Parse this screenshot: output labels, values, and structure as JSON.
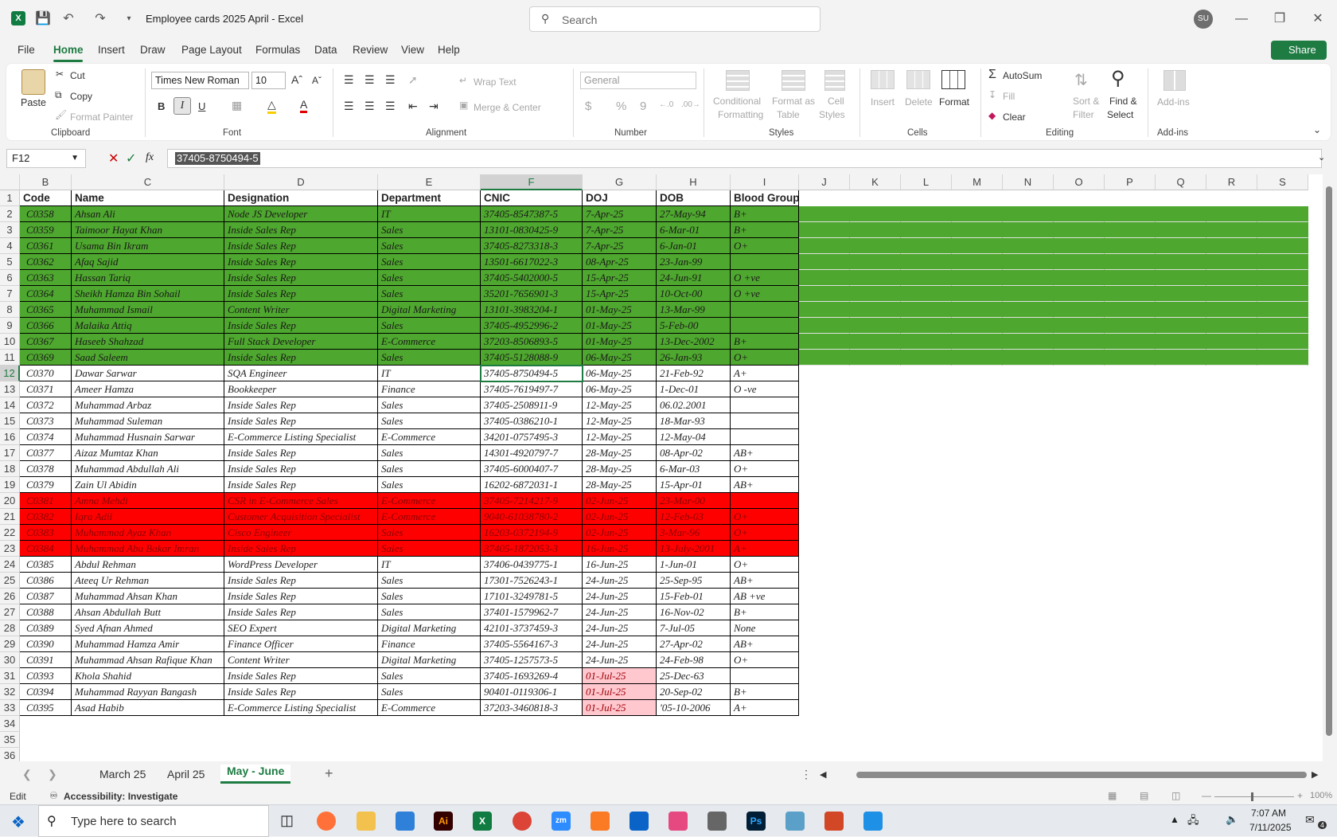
{
  "titlebar": {
    "doc_title": "Employee cards 2025 April  -  Excel",
    "search_placeholder": "Search",
    "avatar": "SU"
  },
  "menu": [
    "File",
    "Home",
    "Insert",
    "Draw",
    "Page Layout",
    "Formulas",
    "Data",
    "Review",
    "View",
    "Help"
  ],
  "share_label": "Share",
  "ribbon": {
    "clipboard": {
      "paste": "Paste",
      "cut": "Cut",
      "copy": "Copy",
      "format_painter": "Format Painter",
      "label": "Clipboard"
    },
    "font": {
      "name": "Times New Roman",
      "size": "10",
      "bold": "B",
      "italic": "I",
      "underline": "U",
      "label": "Font"
    },
    "alignment": {
      "wrap": "Wrap Text",
      "merge": "Merge & Center",
      "label": "Alignment"
    },
    "number": {
      "format": "General",
      "dollar": "$",
      "percent": "%",
      "comma": "9",
      "label": "Number"
    },
    "styles": {
      "cond1": "Conditional",
      "cond2": "Formatting",
      "fmt1": "Format as",
      "fmt2": "Table",
      "cell1": "Cell",
      "cell2": "Styles",
      "label": "Styles"
    },
    "cells": {
      "insert": "Insert",
      "delete": "Delete",
      "format": "Format",
      "label": "Cells"
    },
    "editing": {
      "autosum": "AutoSum",
      "fill": "Fill",
      "clear": "Clear",
      "sort1": "Sort &",
      "sort2": "Filter",
      "find1": "Find &",
      "find2": "Select",
      "label": "Editing"
    },
    "addins": {
      "btn": "Add-ins",
      "label": "Add-ins"
    }
  },
  "formula": {
    "namebox": "F12",
    "value": "37405-8750494-5"
  },
  "columns": [
    "B",
    "C",
    "D",
    "E",
    "F",
    "G",
    "H",
    "I",
    "J",
    "K",
    "L",
    "M",
    "N",
    "O",
    "P",
    "Q",
    "R",
    "S"
  ],
  "headers": [
    "Code",
    "Name",
    "Designation",
    "Department",
    "CNIC",
    "DOJ",
    "DOB",
    "Blood Group"
  ],
  "rows": [
    [
      "C0358",
      "Ahsan Ali",
      "Node JS Developer",
      "IT",
      "37405-8547387-5",
      "7-Apr-25",
      "27-May-94",
      "B+"
    ],
    [
      "C0359",
      "Taimoor Hayat Khan",
      "Inside Sales Rep",
      "Sales",
      "13101-0830425-9",
      "7-Apr-25",
      "6-Mar-01",
      "B+"
    ],
    [
      "C0361",
      "Usama Bin Ikram",
      "Inside Sales Rep",
      "Sales",
      "37405-8273318-3",
      "7-Apr-25",
      "6-Jan-01",
      "O+"
    ],
    [
      "C0362",
      "Afaq Sajid",
      "Inside Sales Rep",
      "Sales",
      "13501-6617022-3",
      "08-Apr-25",
      "23-Jan-99",
      ""
    ],
    [
      "C0363",
      "Hassan Tariq",
      "Inside Sales Rep",
      "Sales",
      "37405-5402000-5",
      "15-Apr-25",
      "24-Jun-91",
      "O +ve"
    ],
    [
      "C0364",
      "Sheikh Hamza Bin Sohail",
      "Inside Sales Rep",
      "Sales",
      "35201-7656901-3",
      "15-Apr-25",
      "10-Oct-00",
      "O +ve"
    ],
    [
      "C0365",
      "Muhammad Ismail",
      "Content Writer",
      "Digital Marketing",
      "13101-3983204-1",
      "01-May-25",
      "13-Mar-99",
      ""
    ],
    [
      "C0366",
      "Malaika Attiq",
      "Inside Sales Rep",
      "Sales",
      "37405-4952996-2",
      "01-May-25",
      "5-Feb-00",
      ""
    ],
    [
      "C0367",
      "Haseeb Shahzad",
      "Full Stack Developer",
      "E-Commerce",
      "37203-8506893-5",
      "01-May-25",
      "13-Dec-2002",
      "B+"
    ],
    [
      "C0369",
      "Saad Saleem",
      "Inside Sales Rep",
      "Sales",
      "37405-5128088-9",
      "06-May-25",
      "26-Jan-93",
      "O+"
    ],
    [
      "C0370",
      "Dawar Sarwar",
      "SQA Engineer",
      "IT",
      "37405-8750494-5",
      "06-May-25",
      "21-Feb-92",
      "A+"
    ],
    [
      "C0371",
      "Ameer Hamza",
      "Bookkeeper",
      "Finance",
      "37405-7619497-7",
      "06-May-25",
      "1-Dec-01",
      "O -ve"
    ],
    [
      "C0372",
      "Muhammad Arbaz",
      "Inside Sales Rep",
      "Sales",
      "37405-2508911-9",
      "12-May-25",
      "06.02.2001",
      ""
    ],
    [
      "C0373",
      "Muhammad Suleman",
      "Inside Sales Rep",
      "Sales",
      "37405-0386210-1",
      "12-May-25",
      "18-Mar-93",
      ""
    ],
    [
      "C0374",
      "Muhammad Husnain Sarwar",
      "E-Commerce Listing Specialist",
      "E-Commerce",
      "34201-0757495-3",
      "12-May-25",
      "12-May-04",
      ""
    ],
    [
      "C0377",
      "Aizaz Mumtaz Khan",
      "Inside Sales Rep",
      "Sales",
      "14301-4920797-7",
      "28-May-25",
      "08-Apr-02",
      "AB+"
    ],
    [
      "C0378",
      "Muhammad Abdullah Ali",
      "Inside Sales Rep",
      "Sales",
      "37405-6000407-7",
      "28-May-25",
      "6-Mar-03",
      "O+"
    ],
    [
      "C0379",
      "Zain Ul Abidin",
      "Inside Sales Rep",
      "Sales",
      "16202-6872031-1",
      "28-May-25",
      "15-Apr-01",
      "AB+"
    ],
    [
      "C0381",
      "Amna Mehdi",
      "CSR in E-Commerce Sales",
      "E-Commerce",
      "37405-7214217-9",
      "02-Jun-25",
      "23-Mar-00",
      ""
    ],
    [
      "C0382",
      "Iqra Adil",
      "Customer Acquisition Specialist",
      "E-Commerce",
      "9040-61038780-2",
      "02-Jun-25",
      "12-Feb-03",
      "O+"
    ],
    [
      "C0383",
      "Muhammad Ayaz Khan",
      "Cisco Engineer",
      "Sales",
      "16203-0372194-9",
      "02-Jun-25",
      "3-Mar-96",
      "O+"
    ],
    [
      "C0384",
      "Muhammad Abu Bakar Imran",
      "Inside Sales Rep",
      "Sales",
      "37405-1872053-3",
      "16-Jun-25",
      "13-July-2001",
      "A+"
    ],
    [
      "C0385",
      "Abdul Rehman",
      "WordPress Developer",
      "IT",
      "37406-0439775-1",
      "16-Jun-25",
      "1-Jun-01",
      "O+"
    ],
    [
      "C0386",
      "Ateeq Ur Rehman",
      "Inside Sales Rep",
      "Sales",
      "17301-7526243-1",
      "24-Jun-25",
      "25-Sep-95",
      "AB+"
    ],
    [
      "C0387",
      "Muhammad Ahsan Khan",
      "Inside Sales Rep",
      "Sales",
      "17101-3249781-5",
      "24-Jun-25",
      "15-Feb-01",
      "AB +ve"
    ],
    [
      "C0388",
      "Ahsan Abdullah Butt",
      "Inside Sales Rep",
      "Sales",
      "37401-1579962-7",
      "24-Jun-25",
      "16-Nov-02",
      "B+"
    ],
    [
      "C0389",
      "Syed Afnan Ahmed",
      "SEO Expert",
      "Digital Marketing",
      "42101-3737459-3",
      "24-Jun-25",
      "7-Jul-05",
      "None"
    ],
    [
      "C0390",
      "Muhammad Hamza Amir",
      "Finance Officer",
      "Finance",
      "37405-5564167-3",
      "24-Jun-25",
      "27-Apr-02",
      "AB+"
    ],
    [
      "C0391",
      "Muhammad Ahsan Rafique Khan",
      "Content Writer",
      "Digital Marketing",
      "37405-1257573-5",
      "24-Jun-25",
      "24-Feb-98",
      "O+"
    ],
    [
      "C0393",
      "Khola Shahid",
      "Inside Sales Rep",
      "Sales",
      "37405-1693269-4",
      "01-Jul-25",
      "25-Dec-63",
      ""
    ],
    [
      "C0394",
      "Muhammad Rayyan Bangash",
      "Inside Sales Rep",
      "Sales",
      "90401-0119306-1",
      "01-Jul-25",
      "20-Sep-02",
      "B+"
    ],
    [
      "C0395",
      "Asad Habib",
      "E-Commerce Listing Specialist",
      "E-Commerce",
      "37203-3460818-3",
      "01-Jul-25",
      "'05-10-2006",
      "A+"
    ]
  ],
  "colors": {
    "green": "#4ea72e",
    "red": "#ff0000",
    "pink": "#ffc7ce",
    "accent": "#1e7b42"
  },
  "sheets": [
    "March 25",
    "April 25",
    "May - June"
  ],
  "status": {
    "mode": "Edit",
    "accessibility": "Accessibility: Investigate",
    "zoom": "100%"
  },
  "taskbar": {
    "search_placeholder": "Type here to search",
    "time": "7:07 AM",
    "date": "7/11/2025",
    "notif": "4"
  }
}
